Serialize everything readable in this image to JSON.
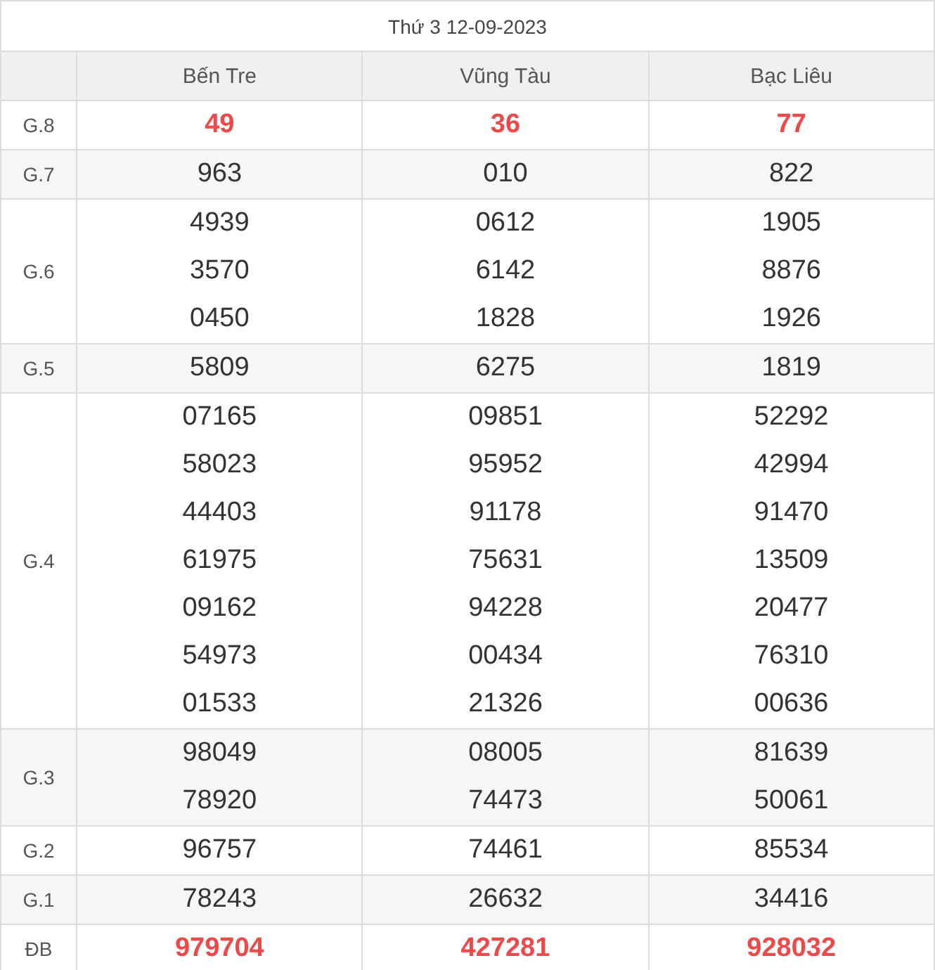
{
  "title": "Thứ 3 12-09-2023",
  "columns": [
    "Bến Tre",
    "Vũng Tàu",
    "Bạc Liêu"
  ],
  "rows": [
    {
      "prize": "G.8",
      "highlight": true,
      "values": [
        [
          "49"
        ],
        [
          "36"
        ],
        [
          "77"
        ]
      ]
    },
    {
      "prize": "G.7",
      "highlight": false,
      "values": [
        [
          "963"
        ],
        [
          "010"
        ],
        [
          "822"
        ]
      ]
    },
    {
      "prize": "G.6",
      "highlight": false,
      "values": [
        [
          "4939",
          "3570",
          "0450"
        ],
        [
          "0612",
          "6142",
          "1828"
        ],
        [
          "1905",
          "8876",
          "1926"
        ]
      ]
    },
    {
      "prize": "G.5",
      "highlight": false,
      "values": [
        [
          "5809"
        ],
        [
          "6275"
        ],
        [
          "1819"
        ]
      ]
    },
    {
      "prize": "G.4",
      "highlight": false,
      "values": [
        [
          "07165",
          "58023",
          "44403",
          "61975",
          "09162",
          "54973",
          "01533"
        ],
        [
          "09851",
          "95952",
          "91178",
          "75631",
          "94228",
          "00434",
          "21326"
        ],
        [
          "52292",
          "42994",
          "91470",
          "13509",
          "20477",
          "76310",
          "00636"
        ]
      ]
    },
    {
      "prize": "G.3",
      "highlight": false,
      "values": [
        [
          "98049",
          "78920"
        ],
        [
          "08005",
          "74473"
        ],
        [
          "81639",
          "50061"
        ]
      ]
    },
    {
      "prize": "G.2",
      "highlight": false,
      "values": [
        [
          "96757"
        ],
        [
          "74461"
        ],
        [
          "85534"
        ]
      ]
    },
    {
      "prize": "G.1",
      "highlight": false,
      "values": [
        [
          "78243"
        ],
        [
          "26632"
        ],
        [
          "34416"
        ]
      ]
    },
    {
      "prize": "ĐB",
      "highlight": true,
      "values": [
        [
          "979704"
        ],
        [
          "427281"
        ],
        [
          "928032"
        ]
      ]
    }
  ]
}
